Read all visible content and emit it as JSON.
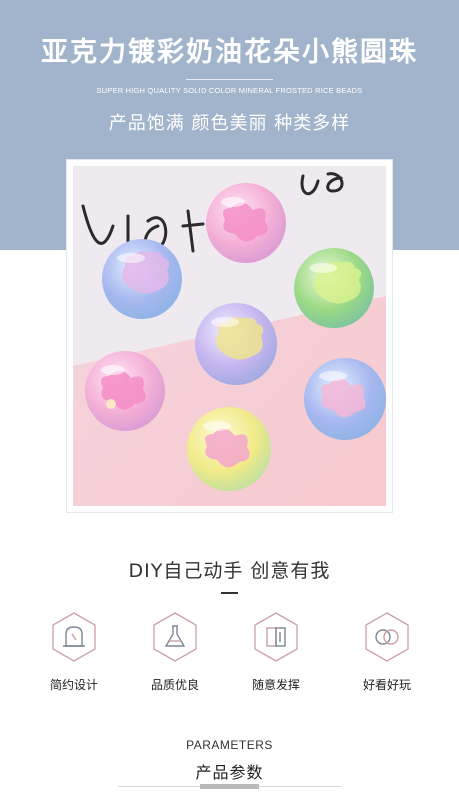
{
  "header": {
    "title": "亚克力镀彩奶油花朵小熊圆珠",
    "subtitle": "SUPER HIGH QUALITY SOLID COLOR MINERAL FROSTED RICE BEADS",
    "tagline": "产品饱满 颜色美丽 种类多样"
  },
  "photo": {
    "background_text": "vita ve",
    "beads": [
      {
        "name": "pink-flower-bead",
        "color": "#f6b6d7",
        "shape": "flower"
      },
      {
        "name": "blue-bear-bead",
        "color": "#a8bdf0",
        "shape": "bear"
      },
      {
        "name": "green-bear-bead",
        "color": "#9bdc88",
        "shape": "bear"
      },
      {
        "name": "purple-bear-bead",
        "color": "#c9b8f0",
        "shape": "bear"
      },
      {
        "name": "pink-flower-bead-2",
        "color": "#f5b4d6",
        "shape": "flower"
      },
      {
        "name": "blue-flower-bead",
        "color": "#a9c4f2",
        "shape": "flower"
      },
      {
        "name": "yellow-flower-bead",
        "color": "#f2ec8a",
        "shape": "flower"
      }
    ]
  },
  "diy": {
    "title": "DIY自己动手 创意有我"
  },
  "features": [
    {
      "label": "简约设计",
      "icon": "mannequin-icon"
    },
    {
      "label": "品质优良",
      "icon": "flask-icon"
    },
    {
      "label": "随意发挥",
      "icon": "book-icon"
    },
    {
      "label": "好看好玩",
      "icon": "rings-icon"
    }
  ],
  "parameters": {
    "en": "PARAMETERS",
    "cn": "产品参数"
  },
  "colors": {
    "header_bg": "#a2b4cb",
    "accent": "#c9a0a6"
  }
}
